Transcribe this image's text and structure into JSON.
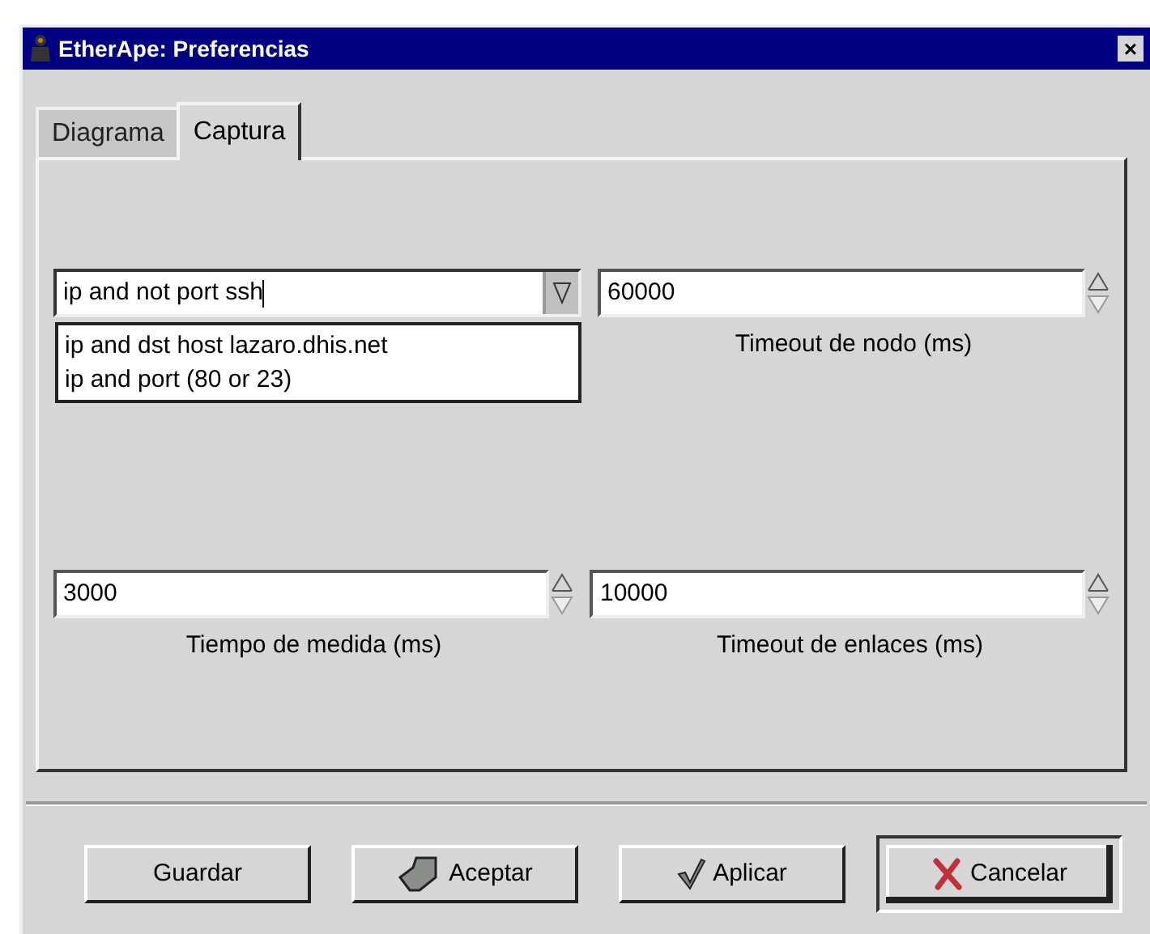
{
  "window": {
    "title": "EtherApe: Preferencias",
    "close": "×"
  },
  "tabs": [
    {
      "label": "Diagrama",
      "selected": false
    },
    {
      "label": "Captura",
      "selected": true
    }
  ],
  "filter": {
    "value": "ip and not port ssh",
    "expanded": true,
    "options": [
      "ip and dst host lazaro.dhis.net",
      "ip and port (80 or 23)"
    ]
  },
  "spins": [
    {
      "value": "60000",
      "label": "Timeout de nodo (ms)"
    },
    {
      "value": "3000",
      "label": "Tiempo de medida (ms)"
    },
    {
      "value": "10000",
      "label": "Timeout de enlaces (ms)"
    }
  ],
  "buttons": [
    {
      "label": "Guardar",
      "kind": "plain",
      "default": false
    },
    {
      "label": "Aceptar",
      "kind": "ok",
      "default": false
    },
    {
      "label": "Aplicar",
      "kind": "apply",
      "default": false
    },
    {
      "label": "Cancelar",
      "kind": "cancel",
      "default": true
    }
  ]
}
